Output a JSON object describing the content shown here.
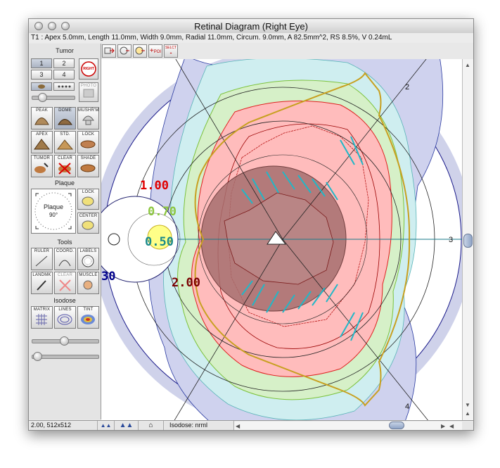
{
  "window": {
    "title": "Retinal Diagram (Right Eye)"
  },
  "info": {
    "text": "T1 : Apex 5.0mm, Length 11.0mm, Width 9.0mm, Radial 11.0mm, Circum. 9.0mm, A 82.5mm^2, RS 8.5%, V 0.24mL"
  },
  "toolbar": {
    "poi_label": "POI",
    "select_label": "SELCT"
  },
  "panel": {
    "tumor_title": "Tumor",
    "tumor_numbers": [
      "1",
      "2",
      "3",
      "4"
    ],
    "right_badge": "RIGHT",
    "photo_label": "PHOTO",
    "shape_buttons": [
      "PEAK",
      "DOME",
      "MUSHR'M",
      "APEX",
      "STD.",
      "LOCK",
      "TUMOR",
      "CLEAR",
      "SHADE"
    ],
    "plaque_title": "Plaque",
    "plaque_dial_label": "Plaque",
    "plaque_angle": "90°",
    "plaque_lock_label": "LOCK",
    "plaque_center_label": "CENTER",
    "tools_title": "Tools",
    "tool_buttons": [
      "RULER",
      "COORD.",
      "LABELS",
      "LANDMK",
      "CLEAR",
      "MUSCLE"
    ],
    "isodose_title": "Isodose",
    "isodose_buttons": [
      "MATRIX",
      "LINES",
      "TINT"
    ]
  },
  "diagram": {
    "meridian_labels": [
      "2",
      "3",
      "4"
    ],
    "isodose_labels": [
      {
        "text": "1.00",
        "color": "#e00000"
      },
      {
        "text": "0.70",
        "color": "#8cc63f"
      },
      {
        "text": "0.50",
        "color": "#1a8a8a"
      },
      {
        "text": "2.00",
        "color": "#7a0000"
      },
      {
        "text": "30",
        "color": "#00008b"
      }
    ]
  },
  "status": {
    "scale": "2.00, 512x512",
    "isodose": "Isodose: nrml"
  },
  "colors": {
    "tumor": "#9c6b6b",
    "isodose_red": "#ffb6b6",
    "isodose_green": "#d6f0c8",
    "isodose_cyan": "#cfeef0",
    "isodose_blue": "#cfd2ee",
    "plaque_outline": "#c8a020"
  }
}
